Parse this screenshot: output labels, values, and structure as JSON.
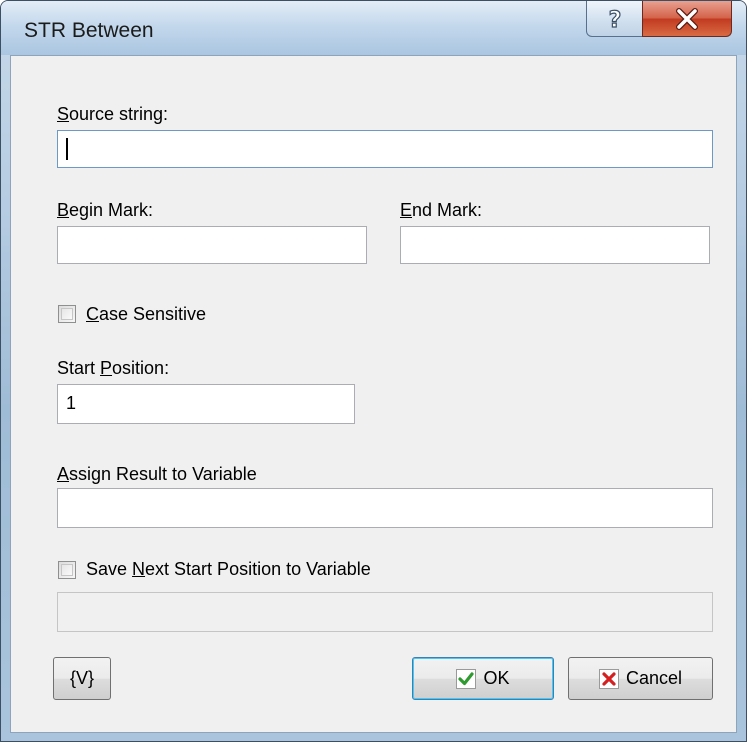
{
  "window": {
    "title": "STR Between",
    "help_glyph": "?",
    "close_glyph": "X"
  },
  "form": {
    "source_string": {
      "label_pre": "",
      "label_mnemonic": "S",
      "label_post": "ource string:",
      "value": ""
    },
    "begin_mark": {
      "label_pre": "",
      "label_mnemonic": "B",
      "label_post": "egin Mark:",
      "value": ""
    },
    "end_mark": {
      "label_pre": "",
      "label_mnemonic": "E",
      "label_post": "nd Mark:",
      "value": ""
    },
    "case_sensitive": {
      "label_pre": "",
      "label_mnemonic": "C",
      "label_post": "ase Sensitive",
      "checked": false
    },
    "start_position": {
      "label_pre": "Start ",
      "label_mnemonic": "P",
      "label_post": "osition:",
      "value": "1"
    },
    "assign_result": {
      "label_pre": "",
      "label_mnemonic": "A",
      "label_post": "ssign Result to Variable",
      "value": ""
    },
    "save_next_start": {
      "label_pre": "Save ",
      "label_mnemonic": "N",
      "label_post": "ext Start Position to Variable",
      "checked": false,
      "value": ""
    }
  },
  "buttons": {
    "variables": "{V}",
    "ok": "OK",
    "cancel": "Cancel"
  },
  "icons": {
    "ok": "checkmark-icon",
    "cancel": "x-mark-icon"
  },
  "colors": {
    "ok_check": "#2f9a2f",
    "cancel_x": "#d42020",
    "close_button": "#c23b21"
  }
}
